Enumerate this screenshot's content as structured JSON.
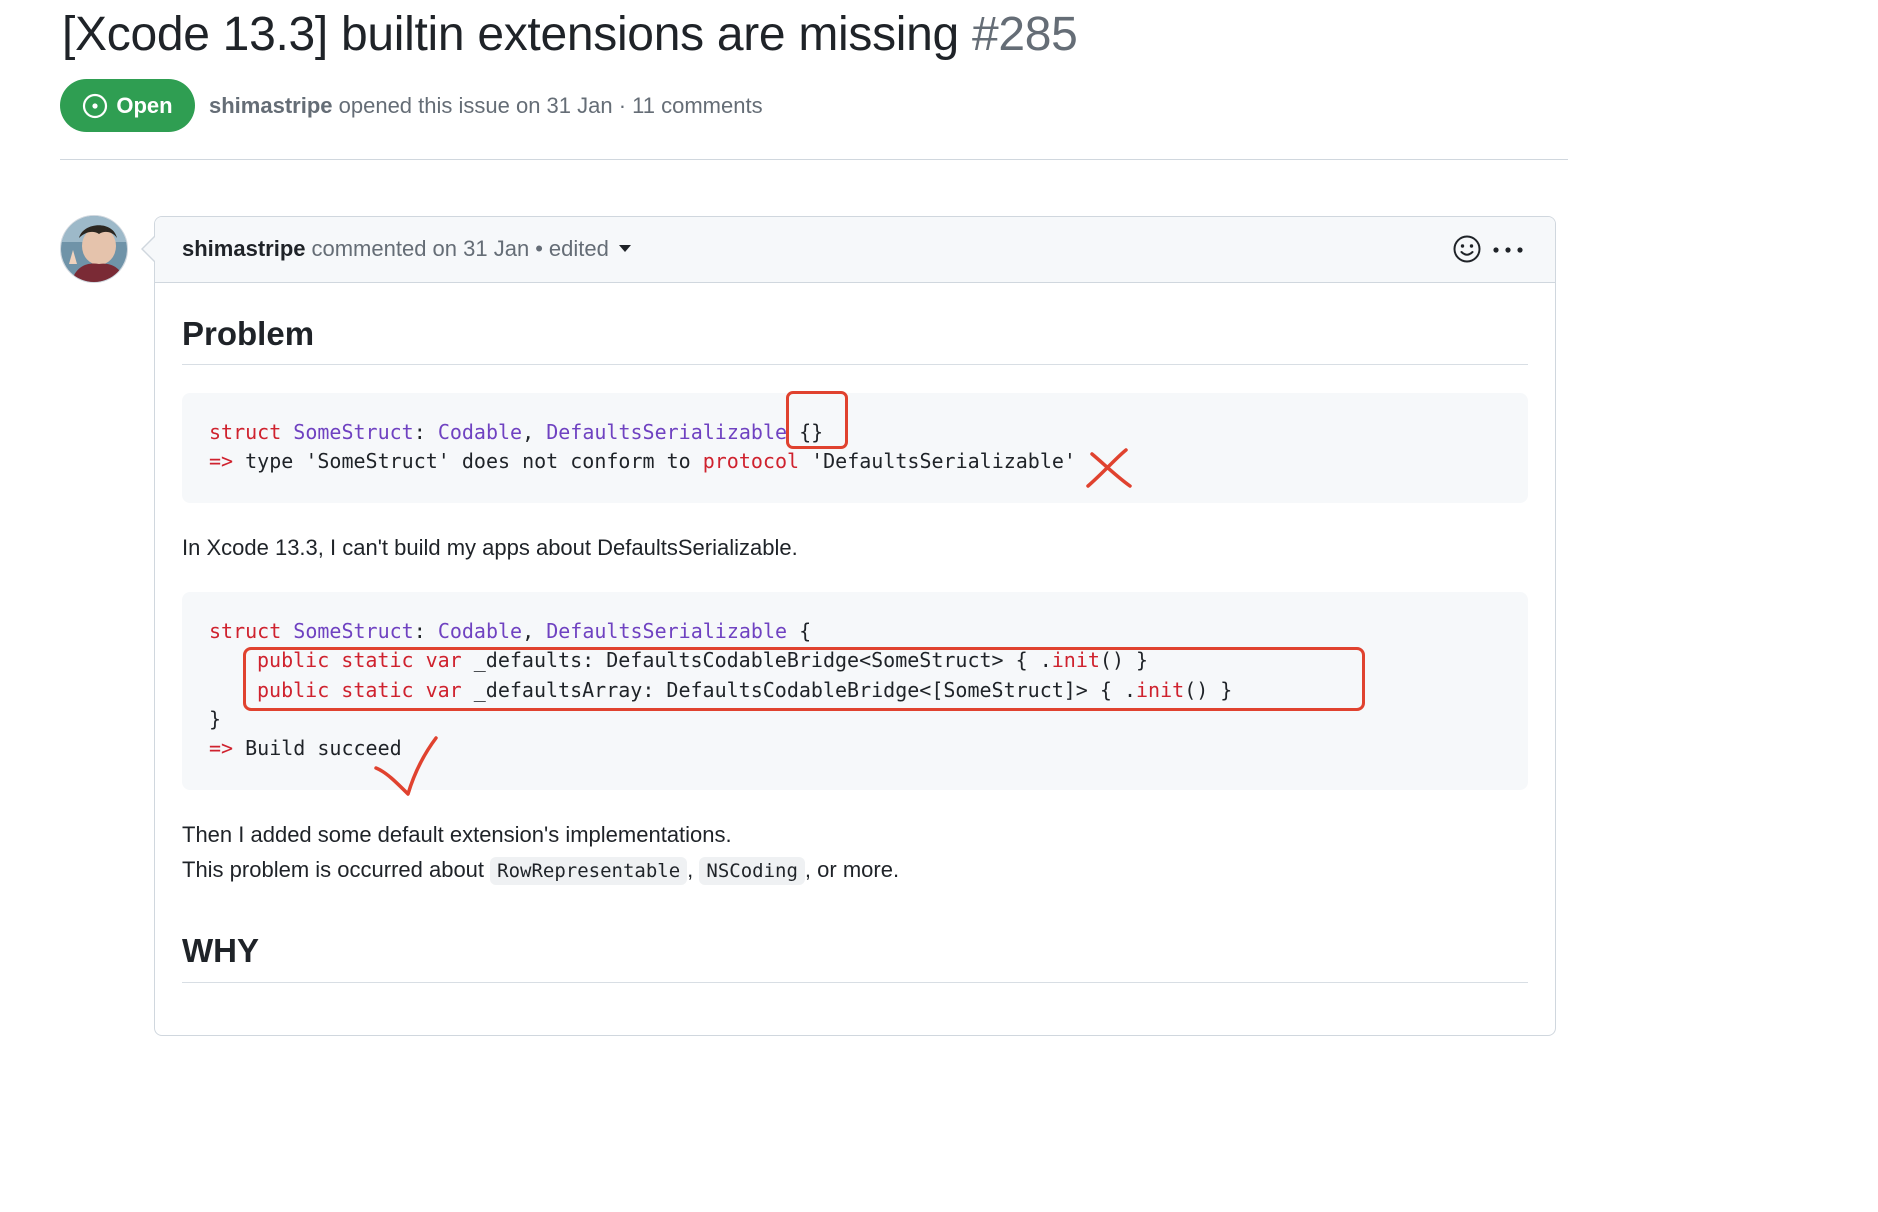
{
  "issue": {
    "title": "[Xcode 13.3] builtin extensions are missing",
    "number": "#285",
    "state_label": "Open",
    "author": "shimastripe",
    "opened_text": "opened this issue on 31 Jan · 11 comments"
  },
  "comment": {
    "author": "shimastripe",
    "meta_text": "commented on 31 Jan",
    "separator": "•",
    "edited_label": "edited",
    "heading_problem": "Problem",
    "heading_why": "WHY",
    "code1": {
      "l1": [
        "struct",
        " ",
        "SomeStruct",
        ": ",
        "Codable",
        ", ",
        "DefaultsSerializable",
        " {}"
      ],
      "l2": [
        "=>",
        " type 'SomeStruct' does not conform to ",
        "protocol",
        " 'DefaultsSerializable'"
      ]
    },
    "paragraph1": "In Xcode 13.3, I can't build my apps about DefaultsSerializable.",
    "code2": {
      "l1": [
        "struct",
        " ",
        "SomeStruct",
        ": ",
        "Codable",
        ", ",
        "DefaultsSerializable",
        " {"
      ],
      "l2": [
        "public",
        " ",
        "static",
        " ",
        "var",
        " _defaults: DefaultsCodableBridge<SomeStruct> { .",
        "init",
        "() }"
      ],
      "l3": [
        "public",
        " ",
        "static",
        " ",
        "var",
        " _defaultsArray: DefaultsCodableBridge<[SomeStruct]> { .",
        "init",
        "() }"
      ],
      "l4": "}",
      "l5": [
        "=>",
        " Build succeed"
      ]
    },
    "paragraph2": "Then I added some default extension's implementations.",
    "paragraph3": {
      "before": "This problem is occurred about ",
      "code_a": "RowRepresentable",
      "comma": ", ",
      "code_b": "NSCoding",
      "after": ", or more."
    }
  },
  "colors": {
    "open_green": "#2f9e52",
    "annotation_red": "#e0422f",
    "keyword_red": "#cf222e",
    "type_purple": "#6f42c1"
  },
  "icons": {
    "state": "issue-opened-icon",
    "reaction": "smiley-icon",
    "menu": "kebab-horizontal-icon",
    "dropdown": "triangle-down-icon"
  }
}
